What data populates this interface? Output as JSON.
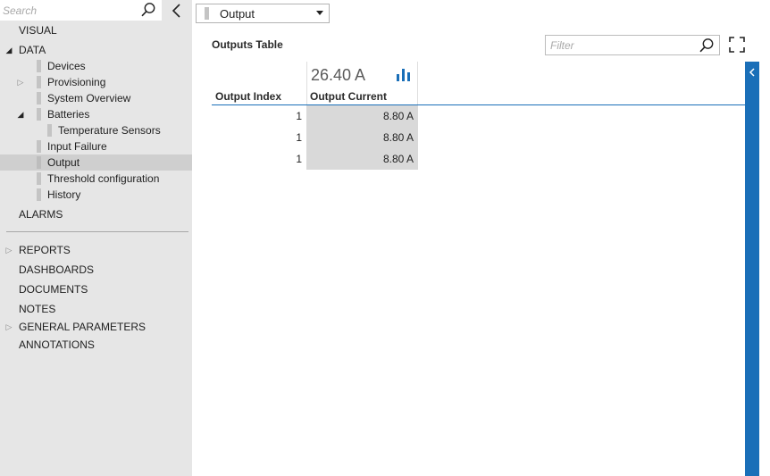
{
  "sidebar": {
    "search_placeholder": "Search",
    "items": [
      {
        "label": "VISUAL"
      },
      {
        "label": "DATA"
      },
      {
        "label": "Devices"
      },
      {
        "label": "Provisioning"
      },
      {
        "label": "System Overview"
      },
      {
        "label": "Batteries"
      },
      {
        "label": "Temperature Sensors"
      },
      {
        "label": "Input Failure"
      },
      {
        "label": "Output"
      },
      {
        "label": "Threshold configuration"
      },
      {
        "label": "History"
      },
      {
        "label": "ALARMS"
      },
      {
        "label": "REPORTS"
      },
      {
        "label": "DASHBOARDS"
      },
      {
        "label": "DOCUMENTS"
      },
      {
        "label": "NOTES"
      },
      {
        "label": "GENERAL PARAMETERS"
      },
      {
        "label": "ANNOTATIONS"
      }
    ],
    "selected": "Output"
  },
  "dropdown": {
    "selected": "Output"
  },
  "main": {
    "title": "Outputs Table",
    "filter_placeholder": "Filter",
    "total_current": "26.40 A",
    "columns": [
      "Output Index",
      "Output Current"
    ],
    "rows": [
      {
        "index": "1",
        "current": "8.80 A"
      },
      {
        "index": "1",
        "current": "8.80 A"
      },
      {
        "index": "1",
        "current": "8.80 A"
      }
    ]
  },
  "colors": {
    "accent": "#1a6fb8",
    "sidebar_bg": "#e6e6e6",
    "selected_bg": "#cfcfcf",
    "cell_bg": "#d9d9d9"
  },
  "icons": {
    "search": "search-icon",
    "collapse": "chevron-left-icon",
    "filter": "search-icon",
    "fullscreen": "fullscreen-icon",
    "chart": "bar-chart-icon",
    "side_panel": "chevron-left-icon"
  }
}
